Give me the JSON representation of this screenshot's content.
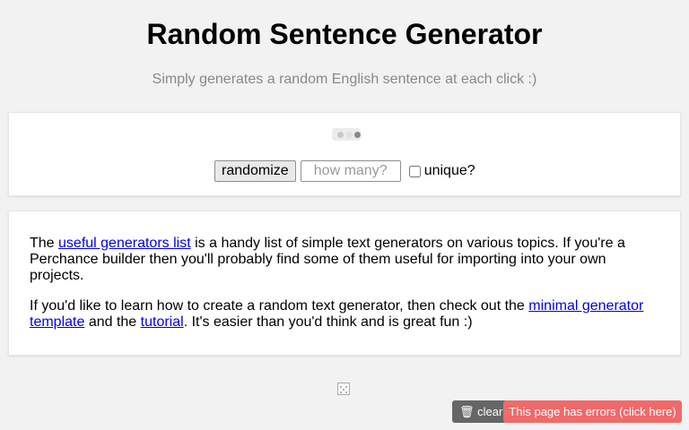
{
  "header": {
    "title": "Random Sentence Generator",
    "subtitle": "Simply generates a random English sentence at each click :)"
  },
  "generator": {
    "randomize_label": "randomize",
    "count_placeholder": "how many?",
    "count_value": "",
    "unique_label": "unique?",
    "unique_checked": false
  },
  "info": {
    "para1": {
      "before": "The ",
      "link": "useful generators list",
      "after": " is a handy list of simple text generators on various topics. If you're a Perchance builder then you'll probably find some of them useful for importing into your own projects."
    },
    "para2": {
      "before": "If you'd like to learn how to create a random text generator, then check out the ",
      "link1": "minimal generator template",
      "middle": " and the ",
      "link2": "tutorial",
      "after": ". It's easier than you'd think and is great fun :)"
    }
  },
  "footer": {
    "clear_icon": "trash-icon",
    "clear_label": "clear",
    "errors_label": "This page has errors (click here)"
  },
  "colors": {
    "background": "#f2f2f2",
    "subtitle": "#888888",
    "link": "#0000ee",
    "clear_button": "#666666",
    "error_button": "#ef6a6a"
  }
}
